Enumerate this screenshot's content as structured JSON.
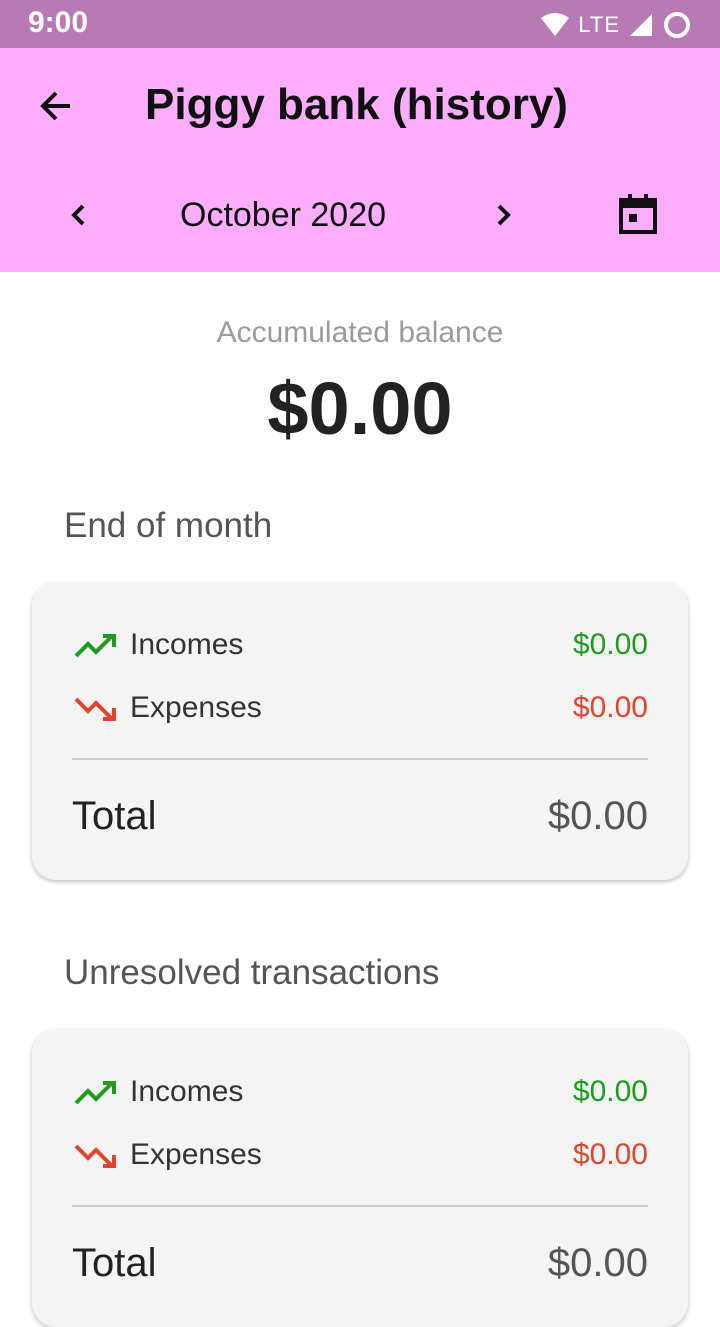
{
  "status_bar": {
    "time": "9:00",
    "network": "LTE"
  },
  "app_bar": {
    "title": "Piggy bank (history)",
    "month": "October 2020"
  },
  "balance": {
    "label": "Accumulated balance",
    "value": "$0.00"
  },
  "sections": [
    {
      "title": "End of month",
      "incomes_label": "Incomes",
      "incomes_value": "$0.00",
      "expenses_label": "Expenses",
      "expenses_value": "$0.00",
      "total_label": "Total",
      "total_value": "$0.00"
    },
    {
      "title": "Unresolved transactions",
      "incomes_label": "Incomes",
      "incomes_value": "$0.00",
      "expenses_label": "Expenses",
      "expenses_value": "$0.00",
      "total_label": "Total",
      "total_value": "$0.00"
    }
  ],
  "colors": {
    "status_bar": "#b77ab5",
    "app_bar": "#feadff",
    "income": "#1e9c1e",
    "expense": "#e0452f"
  },
  "icons": {
    "back": "arrow-back-icon",
    "prev": "chevron-left-icon",
    "next": "chevron-right-icon",
    "calendar": "calendar-icon",
    "income": "trending-up-icon",
    "expense": "trending-down-icon"
  }
}
